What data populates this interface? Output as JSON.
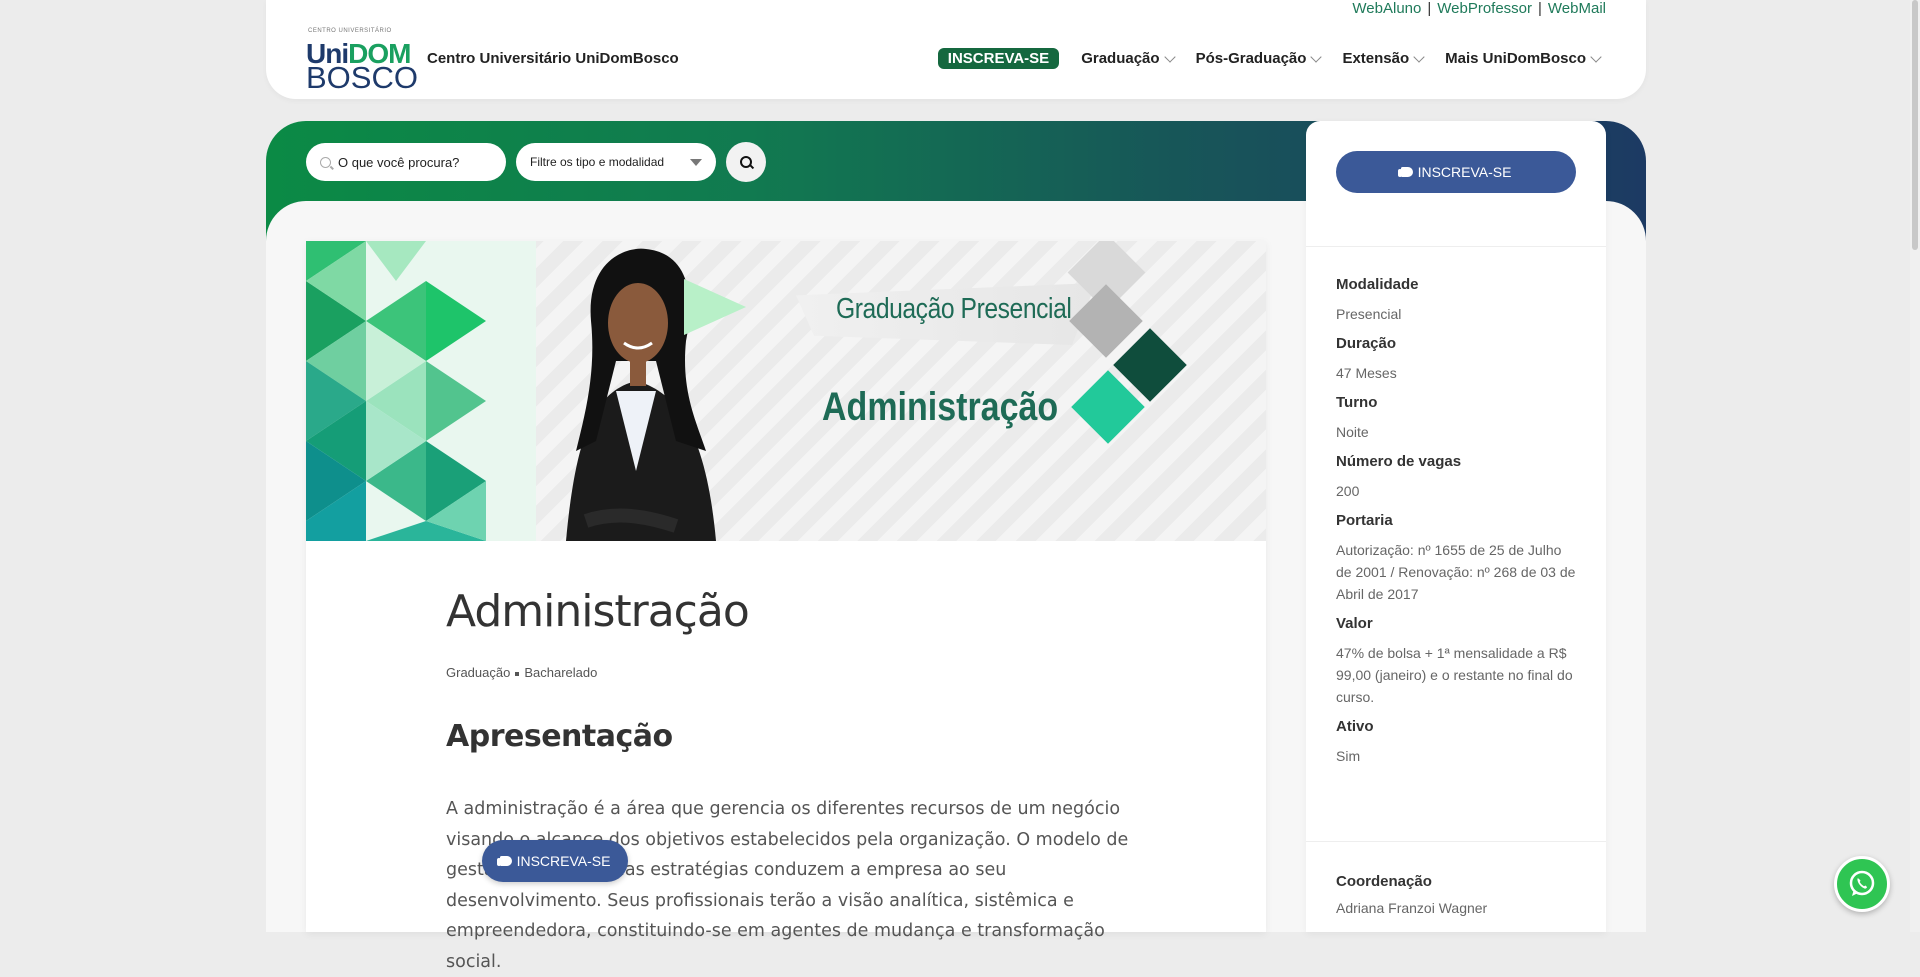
{
  "header": {
    "top_links": [
      "WebAluno",
      "WebProfessor",
      "WebMail"
    ],
    "logo": {
      "small_text": "CENTRO UNIVERSITÁRIO",
      "uni": "Uni",
      "dom": "DOM",
      "bosco": "BOSCO"
    },
    "brand_name": "Centro Universitário UniDomBosco",
    "nav": {
      "cta": "INSCREVA-SE",
      "items": [
        "Graduação",
        "Pós-Graduação",
        "Extensão",
        "Mais UniDomBosco"
      ]
    }
  },
  "search": {
    "placeholder": "O que você procura?",
    "filter_label": "Filtre os tipo e modalidad"
  },
  "banner": {
    "subtitle": "Graduação Presencial",
    "title": "Administração"
  },
  "course": {
    "title": "Administração",
    "breadcrumb": [
      "Graduação",
      "Bacharelado"
    ],
    "section_heading": "Apresentação",
    "paragraph": "A administração é a área que gerencia os diferentes recursos de um negócio visando o alcance dos objetivos estabelecidos pela organização. O modelo de gestão adotado e suas estratégias conduzem a empresa ao seu desenvolvimento. Seus profissionais terão a visão analítica, sistêmica e empreendedora, constituindo-se em agentes de mudança e transformação social."
  },
  "sidebar": {
    "cta": "INSCREVA-SE",
    "info": [
      {
        "label": "Modalidade",
        "value": "Presencial"
      },
      {
        "label": "Duração",
        "value": "47 Meses"
      },
      {
        "label": "Turno",
        "value": "Noite"
      },
      {
        "label": "Número de vagas",
        "value": "200"
      },
      {
        "label": "Portaria",
        "value": "Autorização: nº 1655 de 25 de Julho de 2001 / Renovação: nº 268 de 03 de Abril de 2017"
      },
      {
        "label": "Valor",
        "value": "47% de bolsa + 1ª mensalidade a R$ 99,00 (janeiro) e o restante no final do curso."
      },
      {
        "label": "Ativo",
        "value": "Sim"
      }
    ],
    "coordination": {
      "label": "Coordenação",
      "value": "Adriana Franzoi Wagner"
    }
  },
  "floating_cta": "INSCREVA-SE",
  "icons": {
    "whatsapp": "whatsapp-icon",
    "search": "search-icon",
    "hand": "hand-pointer-icon",
    "chevron": "chevron-down-icon"
  },
  "colors": {
    "brand_green": "#15683f",
    "brand_blue": "#3b5998",
    "heading_green": "#1e6b56"
  }
}
